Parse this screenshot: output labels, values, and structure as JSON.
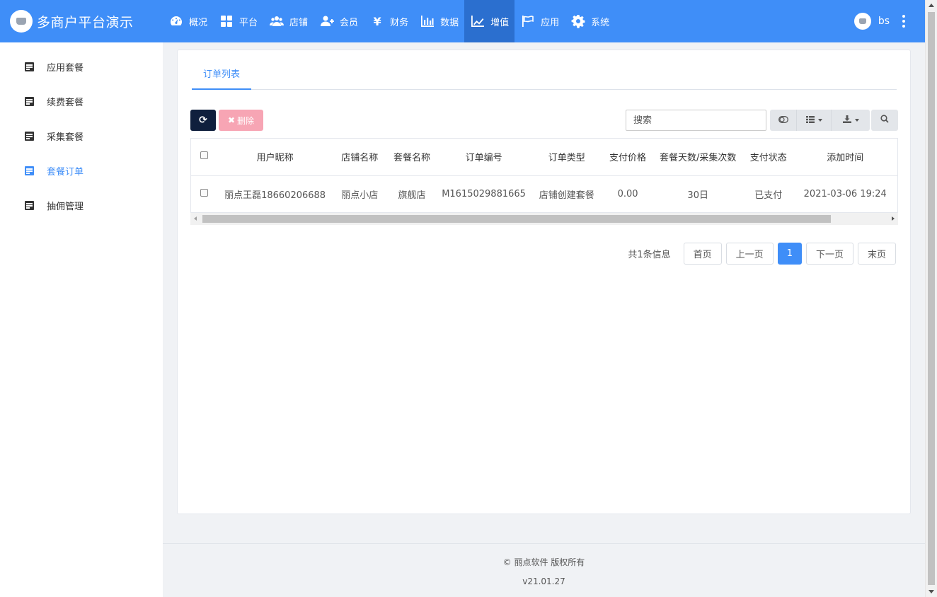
{
  "brand": {
    "title": "多商户平台演示"
  },
  "nav": [
    {
      "label": "概况",
      "icon": "dashboard-icon"
    },
    {
      "label": "平台",
      "icon": "grid-icon"
    },
    {
      "label": "店铺",
      "icon": "users-icon"
    },
    {
      "label": "会员",
      "icon": "user-plus-icon"
    },
    {
      "label": "财务",
      "icon": "yen-icon"
    },
    {
      "label": "数据",
      "icon": "bar-chart-icon"
    },
    {
      "label": "增值",
      "icon": "line-chart-icon",
      "active": true
    },
    {
      "label": "应用",
      "icon": "flag-icon"
    },
    {
      "label": "系统",
      "icon": "gear-icon"
    }
  ],
  "user": {
    "name": "bs"
  },
  "sidebar": {
    "items": [
      {
        "label": "应用套餐"
      },
      {
        "label": "续费套餐"
      },
      {
        "label": "采集套餐"
      },
      {
        "label": "套餐订单",
        "active": true
      },
      {
        "label": "抽佣管理"
      }
    ]
  },
  "tabs": [
    {
      "label": "订单列表"
    }
  ],
  "toolbar": {
    "refresh_icon": "refresh-icon",
    "delete_label": "删除",
    "search_placeholder": "搜索"
  },
  "table": {
    "columns": [
      "用户昵称",
      "店铺名称",
      "套餐名称",
      "订单编号",
      "订单类型",
      "支付价格",
      "套餐天数/采集次数",
      "支付状态",
      "添加时间"
    ],
    "rows": [
      [
        "丽点王磊18660206688",
        "丽点小店",
        "旗舰店",
        "M1615029881665",
        "店铺创建套餐",
        "0.00",
        "30日",
        "已支付",
        "2021-03-06 19:24"
      ]
    ]
  },
  "pagination": {
    "total_text": "共1条信息",
    "first": "首页",
    "prev": "上一页",
    "current": "1",
    "next": "下一页",
    "last": "末页"
  },
  "footer": {
    "copyright": "© 丽点软件 版权所有",
    "version": "v21.01.27"
  },
  "colors": {
    "primary": "#3f8ef8",
    "active_nav": "#2b6fcf",
    "refresh_button": "#0f1f3d",
    "delete_button": "#f7a5b4"
  }
}
